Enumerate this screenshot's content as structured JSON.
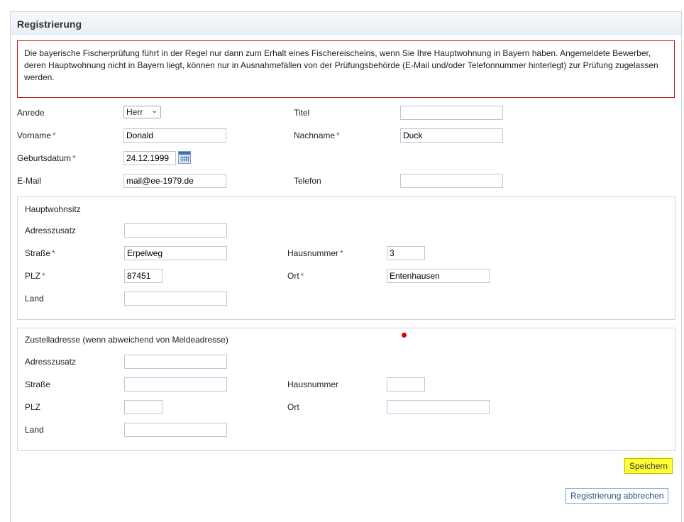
{
  "header": {
    "title": "Registrierung"
  },
  "notice": {
    "text": "Die bayerische Fischerprüfung führt in der Regel nur dann zum Erhalt eines Fischereischeins, wenn Sie Ihre Hauptwohnung in Bayern haben. Angemeldete Bewerber, deren Hauptwohnung nicht in Bayern liegt, können nur in Ausnahmefällen von der Prüfungsbehörde (E-Mail und/oder Telefonnummer hinterlegt) zur Prüfung zugelassen werden."
  },
  "personal": {
    "anrede_label": "Anrede",
    "anrede_value": "Herr",
    "titel_label": "Titel",
    "titel_value": "",
    "vorname_label": "Vorname",
    "vorname_value": "Donald",
    "nachname_label": "Nachname",
    "nachname_value": "Duck",
    "geburtsdatum_label": "Geburtsdatum",
    "geburtsdatum_value": "24.12.1999",
    "email_label": "E-Mail",
    "email_value": "mail@ee-1979.de",
    "telefon_label": "Telefon",
    "telefon_value": "",
    "required_marker": "*"
  },
  "hauptwohnsitz": {
    "legend": "Hauptwohnsitz",
    "adresszusatz_label": "Adresszusatz",
    "adresszusatz_value": "",
    "strasse_label": "Straße",
    "strasse_value": "Erpelweg",
    "hausnummer_label": "Hausnummer",
    "hausnummer_value": "3",
    "plz_label": "PLZ",
    "plz_value": "87451",
    "ort_label": "Ort",
    "ort_value": "Entenhausen",
    "land_label": "Land",
    "land_value": ""
  },
  "zustelladresse": {
    "legend": "Zustelladresse (wenn abweichend von Meldeadresse)",
    "adresszusatz_label": "Adresszusatz",
    "adresszusatz_value": "",
    "strasse_label": "Straße",
    "strasse_value": "",
    "hausnummer_label": "Hausnummer",
    "hausnummer_value": "",
    "plz_label": "PLZ",
    "plz_value": "",
    "ort_label": "Ort",
    "ort_value": "",
    "land_label": "Land",
    "land_value": ""
  },
  "actions": {
    "save_label": "Speichern",
    "cancel_label": "Registrierung abbrechen"
  },
  "colors": {
    "notice_border": "#c7161b",
    "required": "#3d6fb0",
    "save_highlight": "#ffff33",
    "annotation_dot": "#e00000"
  },
  "icons": {
    "calendar": "calendar-icon",
    "select_arrow": "chevron-down-icon"
  }
}
